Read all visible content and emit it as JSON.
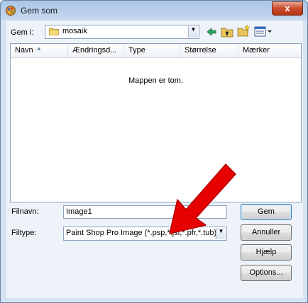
{
  "window": {
    "title": "Gem som",
    "close_label": "x"
  },
  "location": {
    "label": "Gem i:",
    "value": "mosaik"
  },
  "columns": [
    "Navn",
    "Ændringsd...",
    "Type",
    "Størrelse",
    "Mærker"
  ],
  "list": {
    "empty_text": "Mappen er tom."
  },
  "filename": {
    "label": "Filnavn:",
    "value": "Image1"
  },
  "filetype": {
    "label": "Filtype:",
    "value": "Paint Shop Pro Image (*.psp,*.jsl,*.pfr,*.tub)"
  },
  "buttons": {
    "save": "Gem",
    "cancel": "Annuller",
    "help": "Hjælp",
    "options": "Options..."
  },
  "icons": [
    "app-icon",
    "folder-icon",
    "back-arrow-icon",
    "up-folder-icon",
    "new-folder-icon",
    "view-menu-icon",
    "red-arrow-annotation"
  ],
  "colors": {
    "accent_arrow": "#e60000",
    "titlebar": "#b8d0ea",
    "close_button": "#c94a2a"
  }
}
